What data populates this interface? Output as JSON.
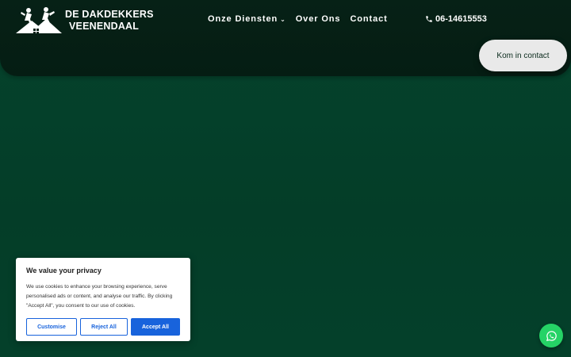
{
  "header": {
    "logo": {
      "line1": "DE DAKDEKKERS",
      "line2": "VEENENDAAL",
      "icon": "roofers-logo-icon"
    },
    "nav": [
      {
        "label": "Onze Diensten",
        "has_dropdown": true
      },
      {
        "label": "Over Ons"
      },
      {
        "label": "Contact"
      }
    ],
    "phone": {
      "icon": "phone-icon",
      "number": "06-14615553"
    },
    "contact_button": "Kom in contact"
  },
  "cookie_banner": {
    "title": "We value your privacy",
    "text": "We use cookies to enhance your browsing experience, serve personalised ads or content, and analyse our traffic. By clicking \"Accept All\", you consent to our use of cookies.",
    "buttons": {
      "customise": "Customise",
      "reject": "Reject All",
      "accept": "Accept All"
    }
  },
  "whatsapp": {
    "icon": "whatsapp-icon"
  },
  "colors": {
    "header_bg": "#062116",
    "hero_bg": "#05432c",
    "accent_blue": "#1863dc",
    "whatsapp_green": "#25d366"
  }
}
